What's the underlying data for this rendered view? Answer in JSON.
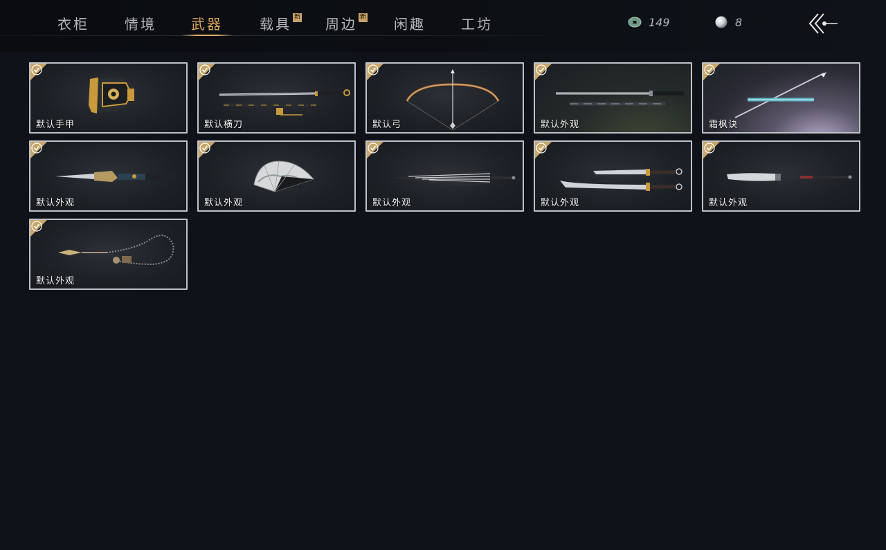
{
  "tabs": [
    {
      "label": "衣柜",
      "active": false,
      "is_new": false
    },
    {
      "label": "情境",
      "active": false,
      "is_new": false
    },
    {
      "label": "武器",
      "active": true,
      "is_new": false
    },
    {
      "label": "载具",
      "active": false,
      "is_new": true
    },
    {
      "label": "周边",
      "active": false,
      "is_new": true
    },
    {
      "label": "闲趣",
      "active": false,
      "is_new": false
    },
    {
      "label": "工坊",
      "active": false,
      "is_new": false
    }
  ],
  "new_badge": "新",
  "currency": {
    "jade_coin": {
      "value": "149",
      "icon": "jade-coin-icon"
    },
    "pearl": {
      "value": "8",
      "icon": "pearl-icon"
    }
  },
  "back_icon": "back-arrow-icon",
  "items": [
    {
      "label": "默认手甲",
      "icon": "gauntlet",
      "equipped": true
    },
    {
      "label": "默认横刀",
      "icon": "sword",
      "equipped": true
    },
    {
      "label": "默认弓",
      "icon": "bow",
      "equipped": true
    },
    {
      "label": "默认外观",
      "icon": "twin-swords",
      "equipped": true
    },
    {
      "label": "霜枫诀",
      "icon": "spear",
      "equipped": true
    },
    {
      "label": "默认外观",
      "icon": "dagger",
      "equipped": true
    },
    {
      "label": "默认外观",
      "icon": "fan",
      "equipped": true
    },
    {
      "label": "默认外观",
      "icon": "umbrella",
      "equipped": true
    },
    {
      "label": "默认外观",
      "icon": "dual-blades",
      "equipped": true
    },
    {
      "label": "默认外观",
      "icon": "glaive",
      "equipped": true
    },
    {
      "label": "默认外观",
      "icon": "rope-dart",
      "equipped": true
    }
  ],
  "colors": {
    "accent": "#d7a45d",
    "check_badge": "#c7a66b",
    "card_border": "#bfc3c7",
    "background": "#0f1319"
  }
}
